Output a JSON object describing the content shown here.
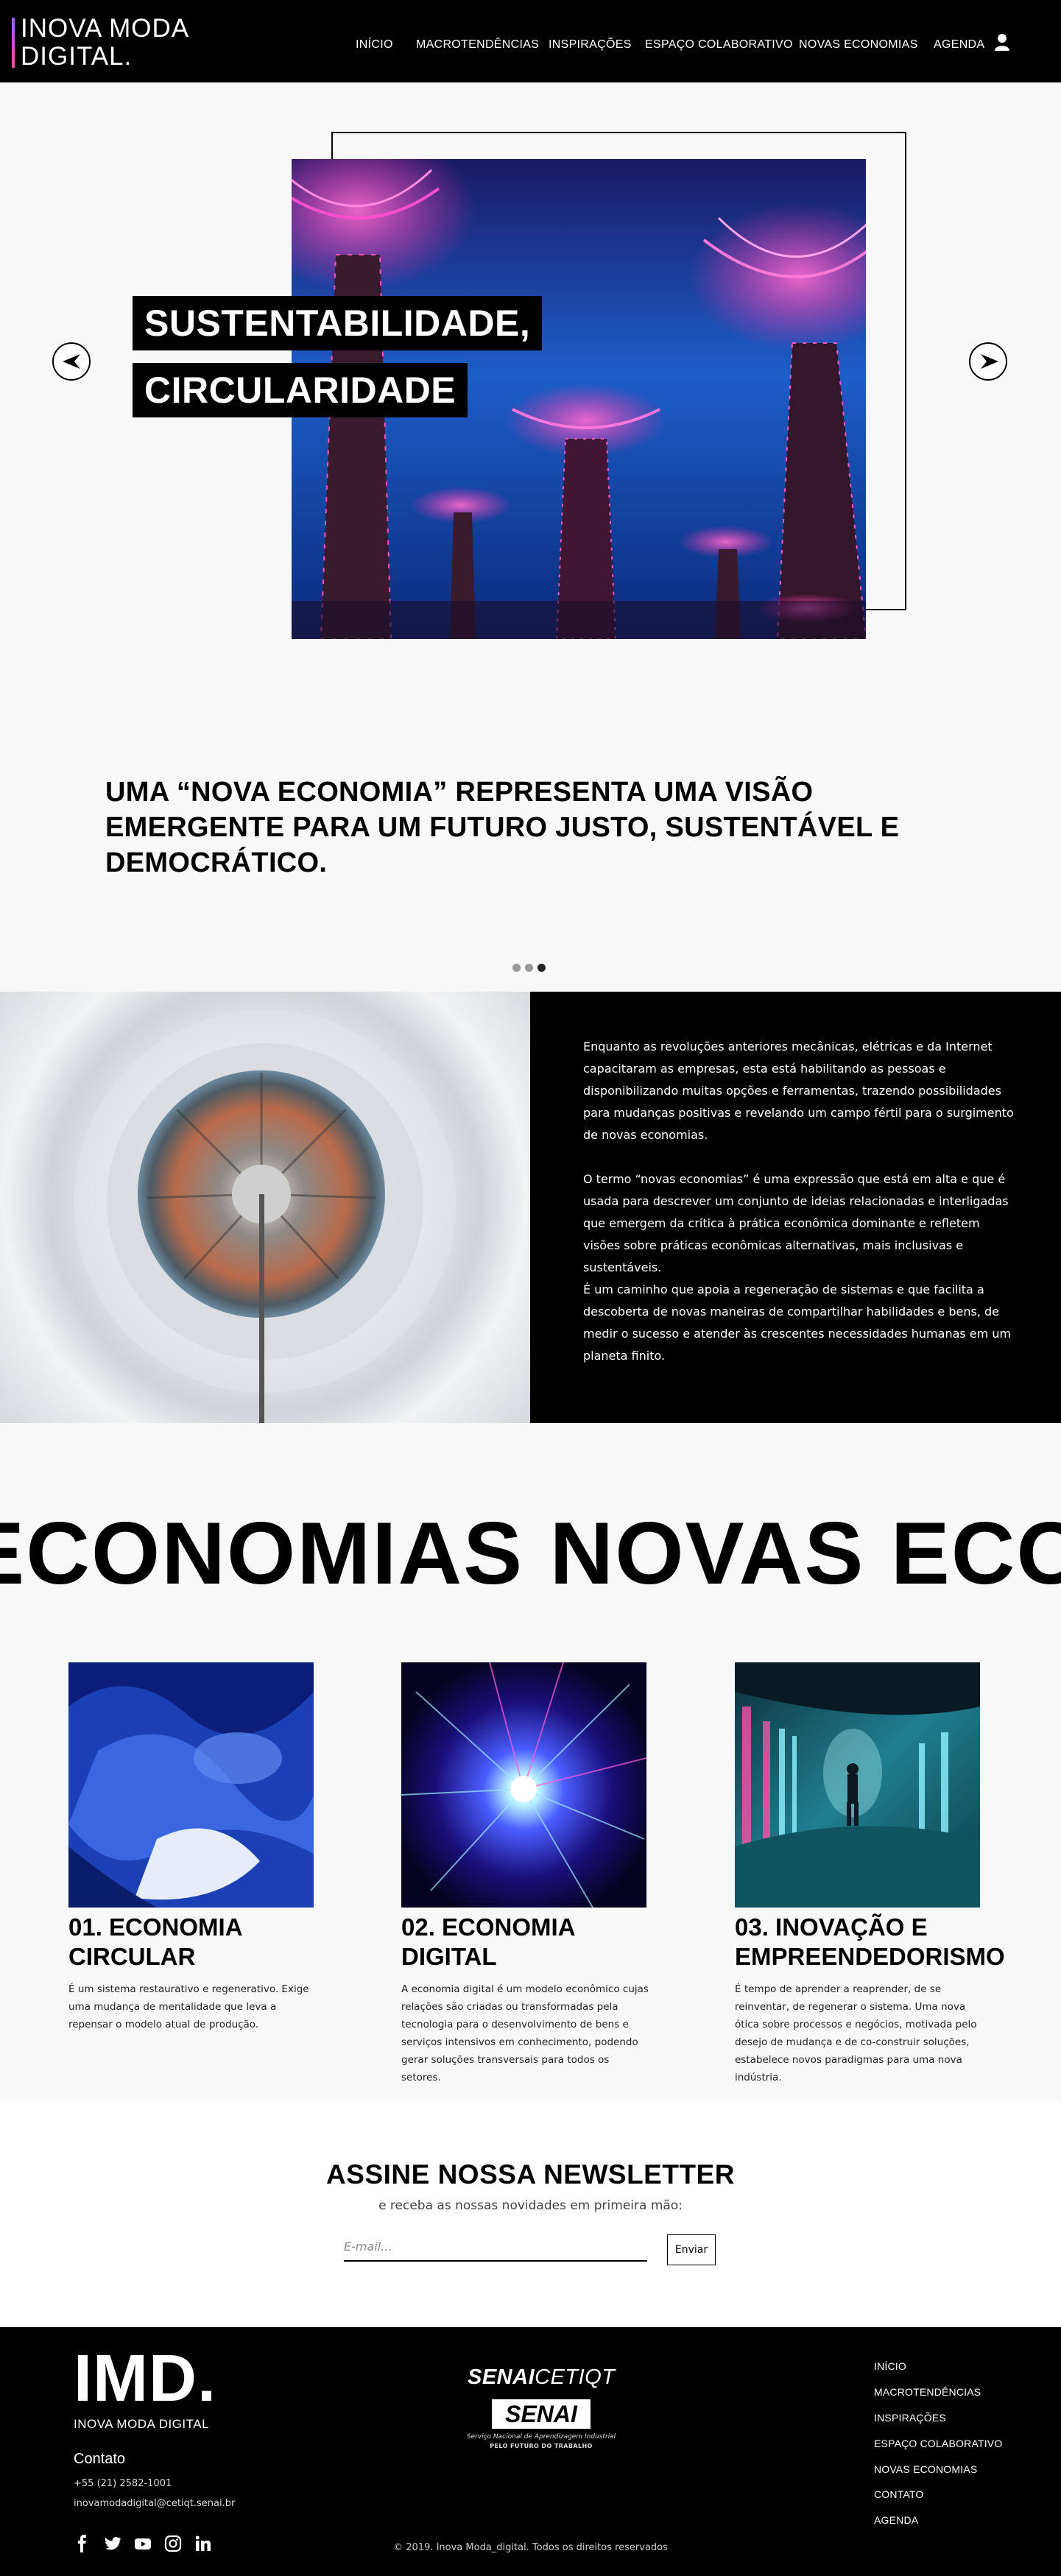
{
  "header": {
    "logo_line1": "INOVA MODA",
    "logo_line2": "DIGITAL.",
    "nav": [
      "INÍCIO",
      "MACROTENDÊNCIAS",
      "INSPIRAÇÕES",
      "ESPAÇO COLABORATIVO",
      "NOVAS ECONOMIAS",
      "AGENDA"
    ]
  },
  "hero": {
    "title_line1": "SUSTENTABILIDADE,",
    "title_line2": "CIRCULARIDADE",
    "quote": "UMA “NOVA ECONOMIA” REPRESENTA UMA VISÃO EMERGENTE PARA UM FUTURO JUSTO, SUSTENTÁVEL E DEMOCRÁTICO.",
    "slides_total": 3,
    "active_slide": 3
  },
  "info": {
    "paragraphs": [
      "Enquanto as revoluções anteriores mecânicas, elétricas e da Internet capacitaram as empresas, esta está habilitando as pessoas e disponibilizando muitas opções e ferramentas, trazendo possibilidades para mudanças positivas e revelando um campo fértil para o surgimento de novas economias.",
      "O termo “novas economias” é uma expressão que está em alta e que é usada para descrever um conjunto de ideias relacionadas e interligadas que emergem da crítica à prática econômica dominante e refletem visões sobre práticas econômicas alternativas, mais inclusivas e sustentáveis.",
      "É um caminho que apoia a regeneração de sistemas e que facilita a descoberta de novas maneiras de compartilhar habilidades e bens, de medir o sucesso e atender às crescentes necessidades humanas em um planeta finito."
    ]
  },
  "marquee": {
    "text": "NOVAS ECONOMIAS     NOVAS ECONOMIAS"
  },
  "cards": [
    {
      "title_line1": "01. ECONOMIA",
      "title_line2": "CIRCULAR",
      "text": "É um sistema restaurativo e regenerativo. Exige uma mudança de mentalidade que leva a repensar o modelo atual de produção."
    },
    {
      "title_line1": "02. ECONOMIA",
      "title_line2": "DIGITAL",
      "text": "A economia digital é um modelo econômico cujas relações são criadas ou transformadas pela tecnologia para o desenvolvimento de bens e serviços intensivos em conhecimento, podendo gerar soluções transversais para todos os setores."
    },
    {
      "title_line1": "03. INOVAÇÃO E",
      "title_line2": "EMPREENDEDORISMO",
      "text": "É tempo de aprender a reaprender, de se reinventar, de regenerar o sistema. Uma nova ótica sobre processos e negócios, motivada pelo desejo de mudança e de co-construir soluções, estabelece novos paradigmas para uma nova indústria."
    }
  ],
  "newsletter": {
    "title": "ASSINE NOSSA NEWSLETTER",
    "subtitle": "e receba as nossas novidades em primeira mão:",
    "email_placeholder": "E-mail...",
    "submit_label": "Enviar"
  },
  "footer": {
    "logo": "IMD.",
    "logo_sub": "INOVA MODA DIGITAL",
    "contact_title": "Contato",
    "phone": "+55 (21) 2582-1001",
    "email": "inovamodadigital@cetiqt.senai.br",
    "partner_bold": "SENAI",
    "partner_light": "CETIQT",
    "senai_box": "SENAI",
    "senai_sub1": "Serviço Nacional de Aprendizagem Industrial",
    "senai_sub2": "PELO FUTURO DO TRABALHO",
    "copyright": "© 2019. Inova Moda_digital. Todos os direitos reservados",
    "links": [
      "INÍCIO",
      "MACROTENDÊNCIAS",
      "INSPIRAÇÕES",
      "ESPAÇO COLABORATIVO",
      "NOVAS ECONOMIAS",
      "CONTATO",
      "AGENDA"
    ],
    "social_icons": [
      "facebook-icon",
      "twitter-icon",
      "youtube-icon",
      "instagram-icon",
      "linkedin-icon"
    ]
  },
  "colors": {
    "black": "#000000",
    "background": "#f8f8f8",
    "accent_pink": "#ff4aa6",
    "accent_purple": "#9b5cff"
  }
}
